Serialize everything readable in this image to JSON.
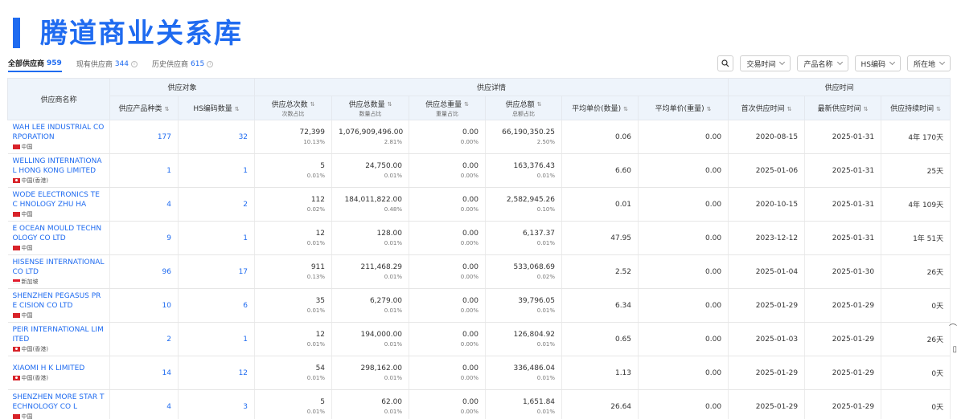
{
  "title": "腾道商业关系库",
  "tabs": [
    {
      "label": "全部供应商",
      "count": "959"
    },
    {
      "label": "现有供应商",
      "count": "344"
    },
    {
      "label": "历史供应商",
      "count": "615"
    }
  ],
  "filters": [
    "交易时间",
    "产品名称",
    "HS编码",
    "所在地"
  ],
  "header": {
    "supplier_name": "供应商名称",
    "group_supply_obj": "供应对象",
    "group_supply_detail": "供应详情",
    "group_supply_time": "供应时间",
    "product_types": "供应产品种类",
    "hs_count": "HS编码数量",
    "total_times": "供应总次数",
    "total_times_sub": "次数占比",
    "total_qty": "供应总数量",
    "total_qty_sub": "数量占比",
    "total_weight": "供应总重量",
    "total_weight_sub": "重量占比",
    "total_amount": "供应总额",
    "total_amount_sub": "总额占比",
    "avg_price_qty": "平均单价(数量)",
    "avg_price_weight": "平均单价(重量)",
    "first_time": "首次供应时间",
    "latest_time": "最新供应时间",
    "duration": "供应持续时间"
  },
  "rows": [
    {
      "name": "WAH LEE INDUSTRIAL CO RPORATION",
      "country": "中国",
      "flag": "cn",
      "types": "177",
      "hs": "32",
      "times": "72,399",
      "times_pct": "10.13%",
      "qty": "1,076,909,496.00",
      "qty_pct": "2.81%",
      "weight": "0.00",
      "weight_pct": "0.00%",
      "amount": "66,190,350.25",
      "amount_pct": "2.50%",
      "avg_qty": "0.06",
      "avg_weight": "0.00",
      "first": "2020-08-15",
      "latest": "2025-01-31",
      "duration": "4年 170天"
    },
    {
      "name": "WELLING INTERNATIONA L HONG KONG LIMITED",
      "country": "中国(香港)",
      "flag": "hk",
      "types": "1",
      "hs": "1",
      "times": "5",
      "times_pct": "0.01%",
      "qty": "24,750.00",
      "qty_pct": "0.01%",
      "weight": "0.00",
      "weight_pct": "0.00%",
      "amount": "163,376.43",
      "amount_pct": "0.01%",
      "avg_qty": "6.60",
      "avg_weight": "0.00",
      "first": "2025-01-06",
      "latest": "2025-01-31",
      "duration": "25天"
    },
    {
      "name": "WODE ELECTRONICS TEC HNOLOGY ZHU HA",
      "country": "中国",
      "flag": "cn",
      "types": "4",
      "hs": "2",
      "times": "112",
      "times_pct": "0.02%",
      "qty": "184,011,822.00",
      "qty_pct": "0.48%",
      "weight": "0.00",
      "weight_pct": "0.00%",
      "amount": "2,582,945.26",
      "amount_pct": "0.10%",
      "avg_qty": "0.01",
      "avg_weight": "0.00",
      "first": "2020-10-15",
      "latest": "2025-01-31",
      "duration": "4年 109天"
    },
    {
      "name": "E OCEAN MOULD TECHN OLOGY CO LTD",
      "country": "中国",
      "flag": "cn",
      "types": "9",
      "hs": "1",
      "times": "12",
      "times_pct": "0.01%",
      "qty": "128.00",
      "qty_pct": "0.01%",
      "weight": "0.00",
      "weight_pct": "0.00%",
      "amount": "6,137.37",
      "amount_pct": "0.01%",
      "avg_qty": "47.95",
      "avg_weight": "0.00",
      "first": "2023-12-12",
      "latest": "2025-01-31",
      "duration": "1年 51天"
    },
    {
      "name": "HISENSE INTERNATIONAL CO LTD",
      "country": "新加坡",
      "flag": "sg",
      "types": "96",
      "hs": "17",
      "times": "911",
      "times_pct": "0.13%",
      "qty": "211,468.29",
      "qty_pct": "0.01%",
      "weight": "0.00",
      "weight_pct": "0.00%",
      "amount": "533,068.69",
      "amount_pct": "0.02%",
      "avg_qty": "2.52",
      "avg_weight": "0.00",
      "first": "2025-01-04",
      "latest": "2025-01-30",
      "duration": "26天"
    },
    {
      "name": "SHENZHEN PEGASUS PRE CISION CO LTD",
      "country": "中国",
      "flag": "cn",
      "types": "10",
      "hs": "6",
      "times": "35",
      "times_pct": "0.01%",
      "qty": "6,279.00",
      "qty_pct": "0.01%",
      "weight": "0.00",
      "weight_pct": "0.00%",
      "amount": "39,796.05",
      "amount_pct": "0.01%",
      "avg_qty": "6.34",
      "avg_weight": "0.00",
      "first": "2025-01-29",
      "latest": "2025-01-29",
      "duration": "0天"
    },
    {
      "name": "PEIR INTERNATIONAL LIM ITED",
      "country": "中国(香港)",
      "flag": "hk",
      "types": "2",
      "hs": "1",
      "times": "12",
      "times_pct": "0.01%",
      "qty": "194,000.00",
      "qty_pct": "0.01%",
      "weight": "0.00",
      "weight_pct": "0.00%",
      "amount": "126,804.92",
      "amount_pct": "0.01%",
      "avg_qty": "0.65",
      "avg_weight": "0.00",
      "first": "2025-01-03",
      "latest": "2025-01-29",
      "duration": "26天"
    },
    {
      "name": "XIAOMI H K LIMITED",
      "country": "中国(香港)",
      "flag": "hk",
      "types": "14",
      "hs": "12",
      "times": "54",
      "times_pct": "0.01%",
      "qty": "298,162.00",
      "qty_pct": "0.01%",
      "weight": "0.00",
      "weight_pct": "0.00%",
      "amount": "336,486.04",
      "amount_pct": "0.01%",
      "avg_qty": "1.13",
      "avg_weight": "0.00",
      "first": "2025-01-29",
      "latest": "2025-01-29",
      "duration": "0天"
    },
    {
      "name": "SHENZHEN MORE STAR T ECHNOLOGY CO L",
      "country": "中国",
      "flag": "cn",
      "types": "4",
      "hs": "3",
      "times": "5",
      "times_pct": "0.01%",
      "qty": "62.00",
      "qty_pct": "0.01%",
      "weight": "0.00",
      "weight_pct": "0.00%",
      "amount": "1,651.84",
      "amount_pct": "0.01%",
      "avg_qty": "26.64",
      "avg_weight": "0.00",
      "first": "2025-01-29",
      "latest": "2025-01-29",
      "duration": "0天"
    }
  ]
}
